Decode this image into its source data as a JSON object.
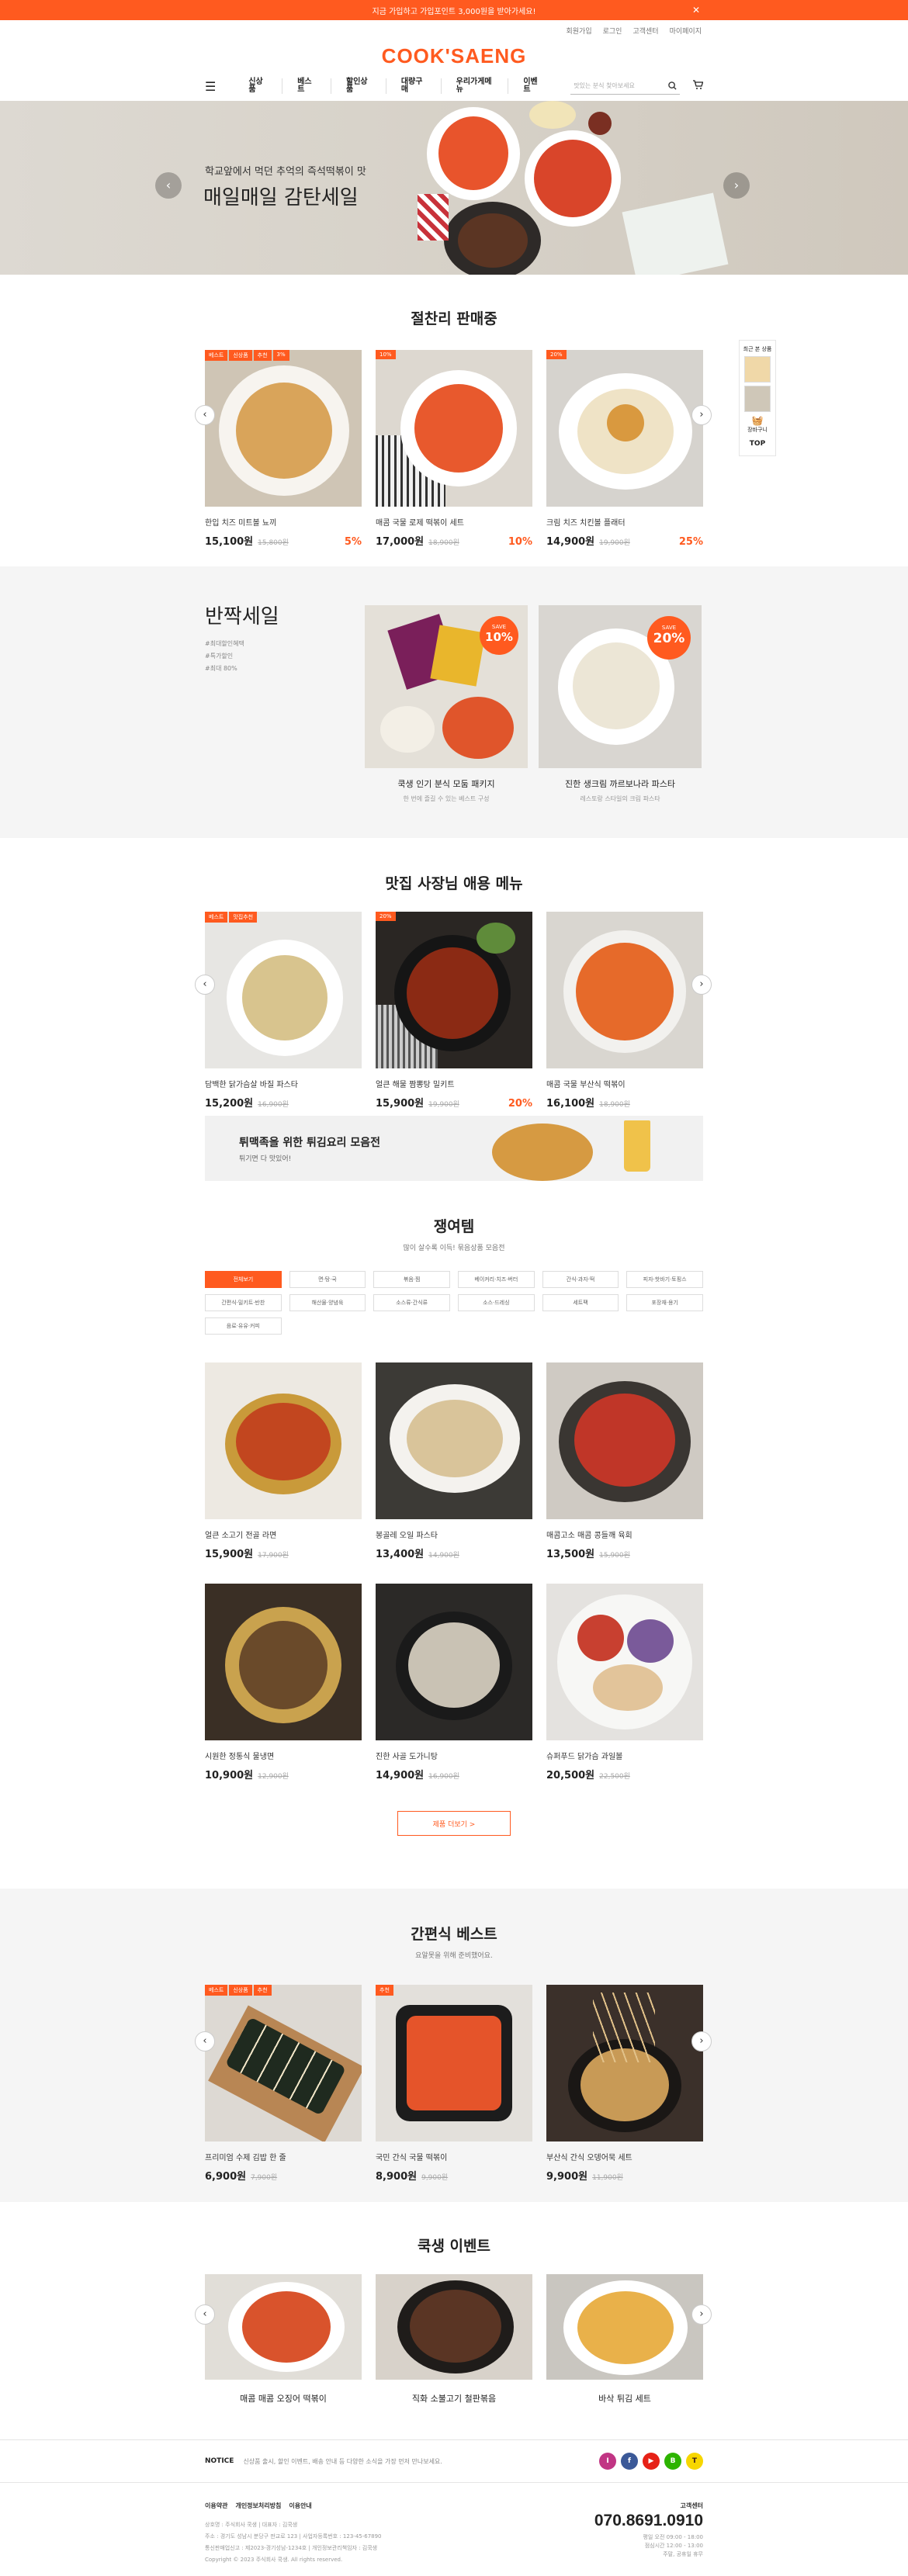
{
  "topbar": {
    "message": "지금 가입하고 가입포인트 3,000원을 받아가세요!",
    "close": "✕"
  },
  "util_links": [
    "회원가입",
    "로그인",
    "고객센터",
    "마이페이지"
  ],
  "logo": "COOK'SAENG",
  "nav": {
    "items": [
      "신상품",
      "베스트",
      "할인상품",
      "대량구매",
      "우리가게메뉴",
      "이벤트"
    ],
    "search_placeholder": "맛있는 분식 찾아보세요"
  },
  "hero": {
    "subtitle": "학교앞에서 먹던 추억의 즉석떡볶이 맛",
    "title": "매일매일 감탄세일"
  },
  "hot_sale": {
    "title": "절찬리 판매중",
    "items": [
      {
        "tags": [
          "베스트",
          "신상품",
          "추천",
          "3%"
        ],
        "name": "한입 치즈 미트볼 뇨끼",
        "price": "15,100원",
        "orig": "15,800원",
        "pct": "5%"
      },
      {
        "tags": [
          "10%"
        ],
        "name": "매콤 국물 로제 떡볶이 세트",
        "price": "17,000원",
        "orig": "18,900원",
        "pct": "10%"
      },
      {
        "tags": [
          "20%"
        ],
        "name": "크림 치즈 치킨볼 플래터",
        "price": "14,900원",
        "orig": "19,900원",
        "pct": "25%"
      }
    ]
  },
  "side_widget": {
    "title": "최근 본 상품",
    "cart": "장바구니",
    "top": "TOP"
  },
  "flash_sale": {
    "title": "반짝세일",
    "hashtags": [
      "#최대할인혜택",
      "#특가할인",
      "#최대 80%"
    ],
    "items": [
      {
        "badge_label": "SAVE",
        "badge_pct": "10%",
        "name": "쿡생 인기 분식 모둠 패키지",
        "desc": "한 번에 즐길 수 있는 베스트 구성"
      },
      {
        "badge_label": "SAVE",
        "badge_pct": "20%",
        "name": "진한 생크림 까르보나라 파스타",
        "desc": "레스토랑 스타일의 크림 파스타"
      }
    ]
  },
  "owner_menu": {
    "title": "맛집 사장님 애용 메뉴",
    "items": [
      {
        "tags": [
          "베스트",
          "맛집추천"
        ],
        "name": "담백한 닭가슴살 바질 파스타",
        "price": "15,200원",
        "orig": "16,900원",
        "pct": ""
      },
      {
        "tags": [
          "20%"
        ],
        "name": "얼큰 해물 짬뽕탕 밀키트",
        "price": "15,900원",
        "orig": "19,900원",
        "pct": "20%"
      },
      {
        "tags": [],
        "name": "매콤 국물 부산식 떡볶이",
        "price": "16,100원",
        "orig": "18,900원",
        "pct": ""
      }
    ]
  },
  "fried_banner": {
    "title": "튀맥족을 위한 튀김요리 모음전",
    "sub": "튀기면 다 맛있어!"
  },
  "jjaem": {
    "title": "쟁여템",
    "sub": "많이 살수록 이득! 묶음상품 모음전",
    "filters": [
      "전체보기",
      "면·탕·국",
      "볶음·찜",
      "베이커리·치즈·버터",
      "간식·과자·떡",
      "피자·핫바기·토핑스",
      "간편식·밀키트·반찬",
      "해산물·양념육",
      "소스류·간식류",
      "소스·드레싱",
      "세트팩",
      "포장재·용기",
      "음료·유유·커피"
    ],
    "items": [
      {
        "name": "얼큰 소고기 전골 라면",
        "price": "15,900원",
        "orig": "17,900원"
      },
      {
        "name": "봉골레 오일 파스타",
        "price": "13,400원",
        "orig": "14,900원"
      },
      {
        "name": "매콤고소 매콤 콩들깨 육회",
        "price": "13,500원",
        "orig": "15,900원"
      },
      {
        "name": "시원한 정통식 물냉면",
        "price": "10,900원",
        "orig": "12,900원"
      },
      {
        "name": "진한 사골 도가니탕",
        "price": "14,900원",
        "orig": "16,900원"
      },
      {
        "name": "슈퍼푸드 닭가슴 과일볼",
        "price": "20,500원",
        "orig": "22,500원"
      }
    ],
    "more": "제품 더보기 >"
  },
  "simple_best": {
    "title": "간편식 베스트",
    "sub": "요알못을 위해 준비했어요.",
    "items": [
      {
        "tags": [
          "베스트",
          "신상품",
          "추천"
        ],
        "name": "프리미엄 수제 김밥 한 줄",
        "price": "6,900원",
        "orig": "7,900원"
      },
      {
        "tags": [
          "추천"
        ],
        "name": "국민 간식 국물 떡볶이",
        "price": "8,900원",
        "orig": "9,900원"
      },
      {
        "tags": [],
        "name": "부산식 간식 오뎅어묵 세트",
        "price": "9,900원",
        "orig": "11,900원"
      }
    ]
  },
  "events": {
    "title": "쿡생 이벤트",
    "items": [
      "매콤 매콤 오징어 떡볶이",
      "직화 소불고기 철판볶음",
      "바삭 튀김 세트"
    ]
  },
  "notice": {
    "label": "NOTICE",
    "text": "신상품 출시, 할인 이벤트, 배송 안내 등 다양한 소식을 가장 먼저 만나보세요."
  },
  "social": [
    "I",
    "f",
    "▶",
    "B",
    "T"
  ],
  "footer": {
    "links": [
      "이용약관",
      "개인정보처리방침",
      "이용안내"
    ],
    "info": [
      "상호명 : 주식회사 쿡생 | 대표자 : 김쿡생",
      "주소 : 경기도 성남시 분당구 판교로 123 | 사업자등록번호 : 123-45-67890",
      "통신판매업신고 : 제2023-경기성남-1234호 | 개인정보관리책임자 : 김쿡생",
      "Copyright © 2023 주식회사 쿡생. All rights reserved."
    ],
    "cs_label": "고객센터",
    "tel": "070.8691.0910",
    "hours": [
      "평일 오전 09:00 - 18:00",
      "점심시간 12:00 - 13:00",
      "주말, 공휴일 휴무"
    ]
  },
  "colors": {
    "accent": "#ff5a1f"
  }
}
